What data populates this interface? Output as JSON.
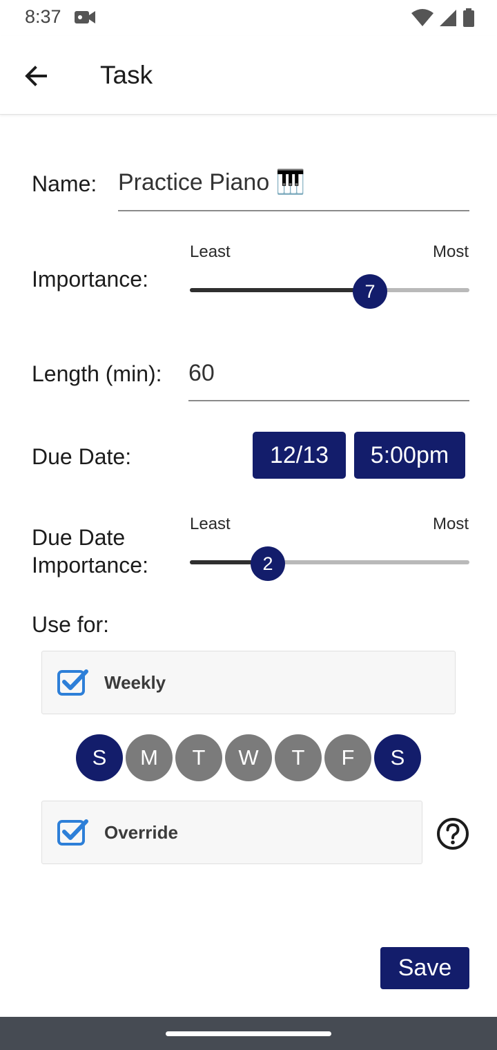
{
  "status_bar": {
    "time": "8:37"
  },
  "app_bar": {
    "title": "Task"
  },
  "form": {
    "name_label": "Name:",
    "name_value": "Practice Piano 🎹",
    "importance_label": "Importance:",
    "importance_least": "Least",
    "importance_most": "Most",
    "importance_value": "7",
    "importance_fraction": 0.645,
    "length_label": "Length (min):",
    "length_value": "60",
    "due_date_label": "Due Date:",
    "due_date_value": "12/13",
    "due_time_value": "5:00pm",
    "due_importance_label_1": "Due Date",
    "due_importance_label_2": "Importance:",
    "due_importance_least": "Least",
    "due_importance_most": "Most",
    "due_importance_value": "2",
    "due_importance_fraction": 0.28,
    "use_for_label": "Use for:",
    "weekly_label": "Weekly",
    "weekly_checked": true,
    "days": [
      {
        "label": "S",
        "selected": true
      },
      {
        "label": "M",
        "selected": false
      },
      {
        "label": "T",
        "selected": false
      },
      {
        "label": "W",
        "selected": false
      },
      {
        "label": "T",
        "selected": false
      },
      {
        "label": "F",
        "selected": false
      },
      {
        "label": "S",
        "selected": true
      }
    ],
    "override_label": "Override",
    "override_checked": true,
    "save_label": "Save"
  },
  "colors": {
    "accent": "#131d6b",
    "day_unselected": "#7b7b7b",
    "checkbox": "#2d7fd8"
  }
}
